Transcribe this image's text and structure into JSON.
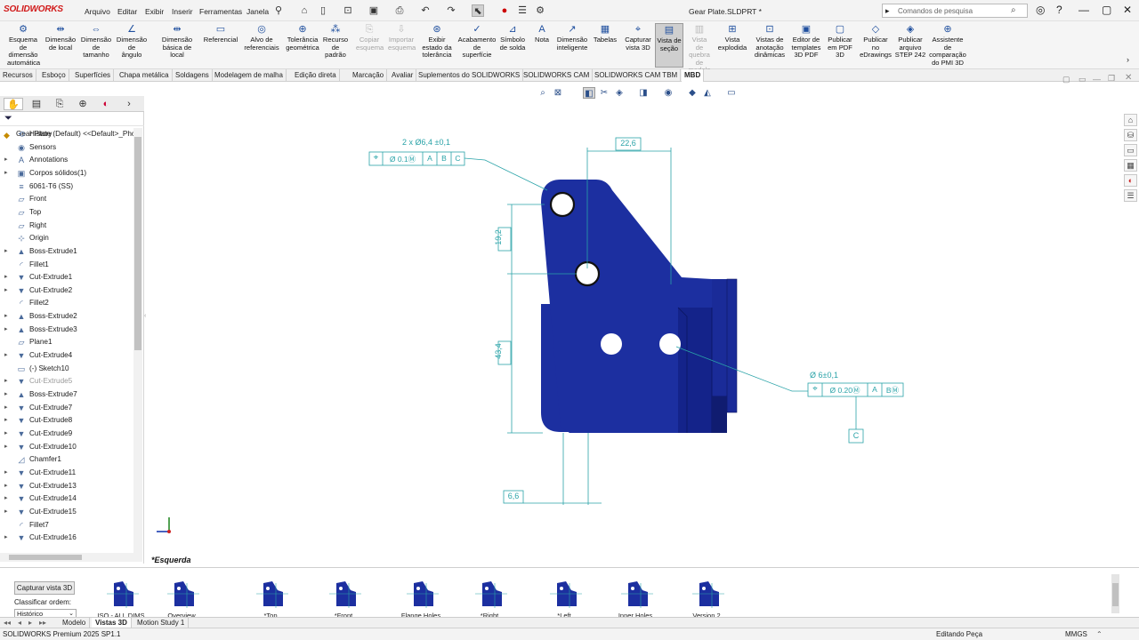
{
  "app": {
    "brand": "SOLIDWORKS",
    "doc_title": "Gear Plate.SLDPRT *"
  },
  "menu": [
    "Arquivo",
    "Editar",
    "Exibir",
    "Inserir",
    "Ferramentas",
    "Janela"
  ],
  "search": {
    "placeholder": "Comandos de pesquisa"
  },
  "ribbon": [
    {
      "label": "Esquema\nde\ndimensão\nautomática",
      "icon": "auto-dimension-scheme-icon",
      "state": "normal"
    },
    {
      "label": "Dimensão\nde local",
      "icon": "location-dimension-icon",
      "state": "normal"
    },
    {
      "label": "Dimensão\nde\ntamanho",
      "icon": "size-dimension-icon",
      "state": "normal"
    },
    {
      "label": "Dimensão\nde\nângulo",
      "icon": "angle-dimension-icon",
      "state": "normal"
    },
    {
      "label": "Dimensão\nbásica de local",
      "icon": "basic-location-dimension-icon",
      "state": "normal"
    },
    {
      "label": "Referencial",
      "icon": "datum-icon",
      "state": "normal"
    },
    {
      "label": "Alvo de\nreferenciais",
      "icon": "datum-target-icon",
      "state": "normal"
    },
    {
      "label": "Tolerância\ngeométrica",
      "icon": "geometric-tolerance-icon",
      "state": "normal"
    },
    {
      "label": "Recurso\nde\npadrão",
      "icon": "pattern-feature-icon",
      "state": "normal"
    },
    {
      "label": "Copiar\nesquema",
      "icon": "copy-scheme-icon",
      "state": "disabled"
    },
    {
      "label": "Importar\nesquema",
      "icon": "import-scheme-icon",
      "state": "disabled"
    },
    {
      "label": "Exibir\nestado da\ntolerância",
      "icon": "tolerance-status-icon",
      "state": "normal"
    },
    {
      "label": "Acabamento\nde\nsuperfície",
      "icon": "surface-finish-icon",
      "state": "normal"
    },
    {
      "label": "Símbolo\nde solda",
      "icon": "weld-symbol-icon",
      "state": "normal"
    },
    {
      "label": "Nota",
      "icon": "note-icon",
      "state": "normal"
    },
    {
      "label": "Dimensão\ninteligente",
      "icon": "smart-dimension-icon",
      "state": "normal"
    },
    {
      "label": "Tabelas",
      "icon": "tables-icon",
      "state": "normal"
    },
    {
      "label": "Capturar\nvista 3D",
      "icon": "capture-3d-view-icon",
      "state": "normal"
    },
    {
      "label": "Vista de\nseção",
      "icon": "section-view-icon",
      "state": "active"
    },
    {
      "label": "Vista\nde\nquebra\nde\nmodelo",
      "icon": "model-break-view-icon",
      "state": "disabled"
    },
    {
      "label": "Vista\nexplodida",
      "icon": "exploded-view-icon",
      "state": "normal"
    },
    {
      "label": "Vistas de\nanotação\ndinâmicas",
      "icon": "dynamic-annotation-views-icon",
      "state": "normal"
    },
    {
      "label": "Editor de\ntemplates\n3D PDF",
      "icon": "3d-pdf-template-editor-icon",
      "state": "normal"
    },
    {
      "label": "Publicar\nem PDF\n3D",
      "icon": "publish-3d-pdf-icon",
      "state": "normal"
    },
    {
      "label": "Publicar\nno\neDrawings",
      "icon": "publish-edrawings-icon",
      "state": "normal"
    },
    {
      "label": "Publicar\narquivo\nSTEP 242",
      "icon": "publish-step-242-icon",
      "state": "normal"
    },
    {
      "label": "Assistente\nde\ncomparação\ndo PMI 3D",
      "icon": "3d-pmi-compare-icon",
      "state": "normal"
    }
  ],
  "tabs": [
    "Recursos",
    "Esboço",
    "Superfícies",
    "Chapa metálica",
    "Soldagens",
    "Modelagem de malha",
    "Edição direta",
    "Marcação",
    "Avaliar",
    "Suplementos do SOLIDWORKS",
    "SOLIDWORKS CAM",
    "SOLIDWORKS CAM TBM",
    "MBD"
  ],
  "active_tab": "MBD",
  "tree": {
    "root": "Gear Plate (Default) <<Default>_Phot",
    "items": [
      {
        "label": "History",
        "icon": "history-icon",
        "expand": false,
        "suppressed": false
      },
      {
        "label": "Sensors",
        "icon": "sensors-icon",
        "expand": false,
        "suppressed": false
      },
      {
        "label": "Annotations",
        "icon": "annotations-icon",
        "expand": true,
        "suppressed": false
      },
      {
        "label": "Corpos sólidos(1)",
        "icon": "solid-bodies-icon",
        "expand": true,
        "suppressed": false
      },
      {
        "label": "6061-T6 (SS)",
        "icon": "material-icon",
        "expand": false,
        "suppressed": false
      },
      {
        "label": "Front",
        "icon": "plane-icon",
        "expand": false,
        "suppressed": false
      },
      {
        "label": "Top",
        "icon": "plane-icon",
        "expand": false,
        "suppressed": false
      },
      {
        "label": "Right",
        "icon": "plane-icon",
        "expand": false,
        "suppressed": false
      },
      {
        "label": "Origin",
        "icon": "origin-icon",
        "expand": false,
        "suppressed": false
      },
      {
        "label": "Boss-Extrude1",
        "icon": "boss-extrude-icon",
        "expand": true,
        "suppressed": false
      },
      {
        "label": "Fillet1",
        "icon": "fillet-icon",
        "expand": false,
        "suppressed": false
      },
      {
        "label": "Cut-Extrude1",
        "icon": "cut-extrude-icon",
        "expand": true,
        "suppressed": false
      },
      {
        "label": "Cut-Extrude2",
        "icon": "cut-extrude-icon",
        "expand": true,
        "suppressed": false
      },
      {
        "label": "Fillet2",
        "icon": "fillet-icon",
        "expand": false,
        "suppressed": false
      },
      {
        "label": "Boss-Extrude2",
        "icon": "boss-extrude-icon",
        "expand": true,
        "suppressed": false
      },
      {
        "label": "Boss-Extrude3",
        "icon": "boss-extrude-icon",
        "expand": true,
        "suppressed": false
      },
      {
        "label": "Plane1",
        "icon": "plane-icon",
        "expand": false,
        "suppressed": false
      },
      {
        "label": "Cut-Extrude4",
        "icon": "cut-extrude-icon",
        "expand": true,
        "suppressed": false
      },
      {
        "label": "(-) Sketch10",
        "icon": "sketch-icon",
        "expand": false,
        "suppressed": false
      },
      {
        "label": "Cut-Extrude5",
        "icon": "cut-extrude-icon",
        "expand": true,
        "suppressed": true
      },
      {
        "label": "Boss-Extrude7",
        "icon": "boss-extrude-icon",
        "expand": true,
        "suppressed": false
      },
      {
        "label": "Cut-Extrude7",
        "icon": "cut-extrude-icon",
        "expand": true,
        "suppressed": false
      },
      {
        "label": "Cut-Extrude8",
        "icon": "cut-extrude-icon",
        "expand": true,
        "suppressed": false
      },
      {
        "label": "Cut-Extrude9",
        "icon": "cut-extrude-icon",
        "expand": true,
        "suppressed": false
      },
      {
        "label": "Cut-Extrude10",
        "icon": "cut-extrude-icon",
        "expand": true,
        "suppressed": false
      },
      {
        "label": "Chamfer1",
        "icon": "chamfer-icon",
        "expand": false,
        "suppressed": false
      },
      {
        "label": "Cut-Extrude11",
        "icon": "cut-extrude-icon",
        "expand": true,
        "suppressed": false
      },
      {
        "label": "Cut-Extrude13",
        "icon": "cut-extrude-icon",
        "expand": true,
        "suppressed": false
      },
      {
        "label": "Cut-Extrude14",
        "icon": "cut-extrude-icon",
        "expand": true,
        "suppressed": false
      },
      {
        "label": "Cut-Extrude15",
        "icon": "cut-extrude-icon",
        "expand": true,
        "suppressed": false
      },
      {
        "label": "Fillet7",
        "icon": "fillet-icon",
        "expand": false,
        "suppressed": false
      },
      {
        "label": "Cut-Extrude16",
        "icon": "cut-extrude-icon",
        "expand": true,
        "suppressed": false
      }
    ]
  },
  "viewport": {
    "view_label": "*Esquerda",
    "model_color": "#1c2fa0",
    "annotation_color": "#2aa3a8",
    "annotations": {
      "hole_callout": "2 x Ø6,4 ±0,1",
      "fcf1": [
        "⌖",
        "Ø 0.1Ⓜ",
        "A",
        "B",
        "C"
      ],
      "dim_top": "22,6",
      "dim_v1": "19,2",
      "dim_v2": "43,4",
      "dim_bottom": "6,6",
      "hole_callout2": "Ø 6±0,1",
      "fcf2": [
        "⌖",
        "Ø 0.20Ⓜ",
        "A",
        "BⓂ"
      ],
      "datum": "C"
    }
  },
  "bottom": {
    "capture_button": "Capturar vista 3D",
    "sort_label": "Classificar ordem:",
    "sort_value": "Histórico",
    "views": [
      "ISO - ALL DIMS",
      "Overview",
      "*Top",
      "*Front",
      "Flange Holes",
      "*Right",
      "*Left",
      "Inner Holes",
      "Version 2"
    ]
  },
  "bottom_tabs": [
    "Modelo",
    "Vistas 3D",
    "Motion Study 1"
  ],
  "active_bottom_tab": "Vistas 3D",
  "status": {
    "product": "SOLIDWORKS Premium 2025 SP1.1",
    "mode": "Editando Peça",
    "units": "MMGS"
  }
}
